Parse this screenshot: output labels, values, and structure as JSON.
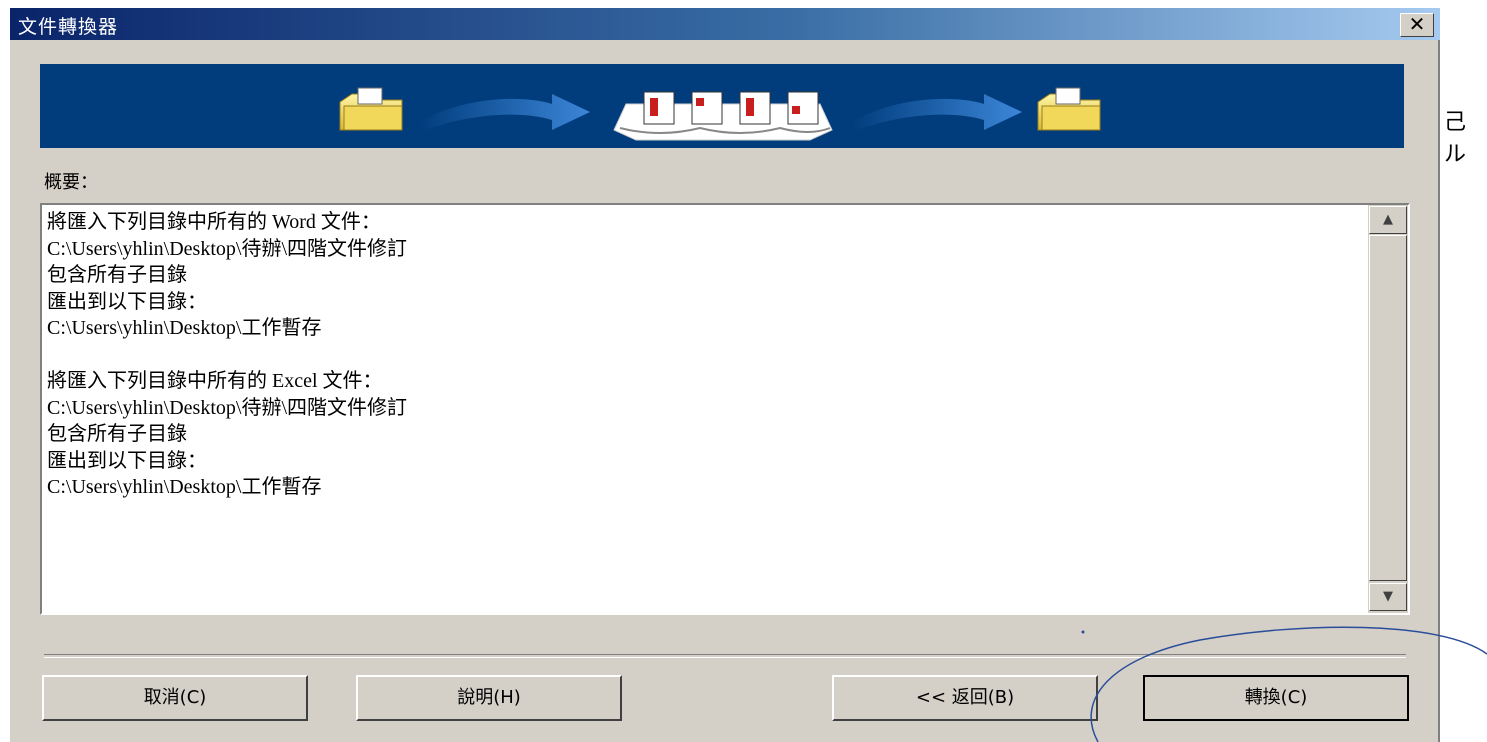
{
  "window": {
    "title": "文件轉換器",
    "close_label": "✕"
  },
  "banner": {
    "description_icons": [
      "source-folder-icon",
      "flow-arrow-icon",
      "documents-icon",
      "flow-arrow-icon",
      "target-folder-icon"
    ]
  },
  "summary": {
    "label": "概要：",
    "lines": [
      "將匯入下列目錄中所有的 Word 文件：",
      "C:\\Users\\yhlin\\Desktop\\待辦\\四階文件修訂",
      "包含所有子目錄",
      "匯出到以下目錄：",
      "C:\\Users\\yhlin\\Desktop\\工作暫存",
      "",
      "將匯入下列目錄中所有的 Excel 文件：",
      "C:\\Users\\yhlin\\Desktop\\待辦\\四階文件修訂",
      "包含所有子目錄",
      "匯出到以下目錄：",
      "C:\\Users\\yhlin\\Desktop\\工作暫存"
    ]
  },
  "buttons": {
    "cancel": "取消(C)",
    "help": "說明(H)",
    "back": "<< 返回(B)",
    "convert": "轉換(C)"
  },
  "background": {
    "edge_text": "己ル"
  },
  "colors": {
    "banner": "#013d7d",
    "title_start": "#0a246a",
    "title_end": "#a6caf0",
    "dialog": "#d4d0c8",
    "annotation": "#2a4d9a"
  }
}
